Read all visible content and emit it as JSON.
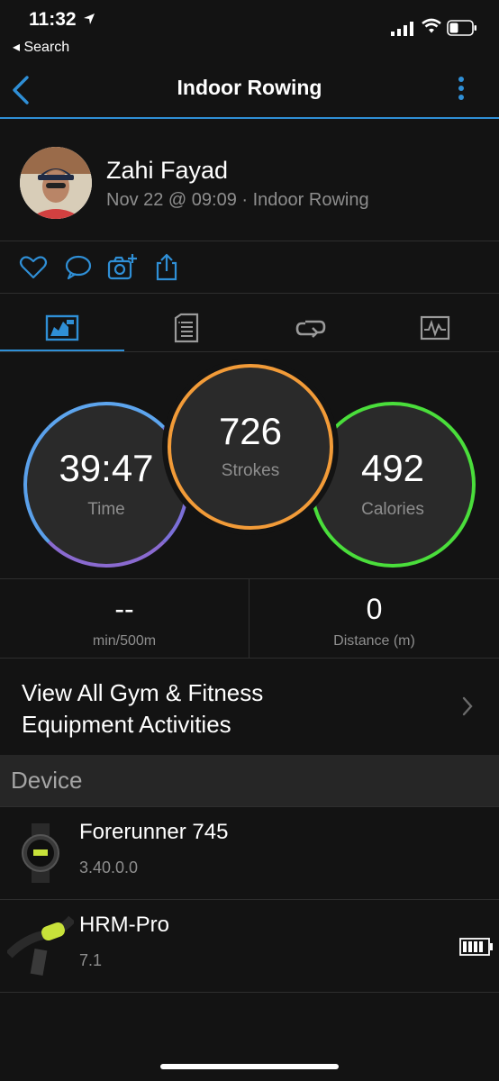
{
  "status_bar": {
    "time": "11:32",
    "back_app": "◂ Search"
  },
  "nav": {
    "title": "Indoor Rowing"
  },
  "activity": {
    "user_name": "Zahi Fayad",
    "meta": "Nov 22 @ 09:09 · Indoor Rowing"
  },
  "stats": {
    "time": {
      "value": "39:47",
      "label": "Time"
    },
    "strokes": {
      "value": "726",
      "label": "Strokes"
    },
    "calories": {
      "value": "492",
      "label": "Calories"
    },
    "pace": {
      "value": "--",
      "label": "min/500m"
    },
    "distance": {
      "value": "0",
      "label": "Distance (m)"
    }
  },
  "view_all": {
    "line1": "View All Gym & Fitness",
    "line2": "Equipment Activities"
  },
  "device": {
    "header": "Device",
    "items": [
      {
        "name": "Forerunner 745",
        "version": "3.40.0.0"
      },
      {
        "name": "HRM-Pro",
        "version": "7.1"
      }
    ]
  },
  "colors": {
    "accent": "#2f8fd6",
    "time_ring": "#6b8fe6",
    "strokes_ring": "#f29b38",
    "calories_ring": "#4ade3b"
  }
}
